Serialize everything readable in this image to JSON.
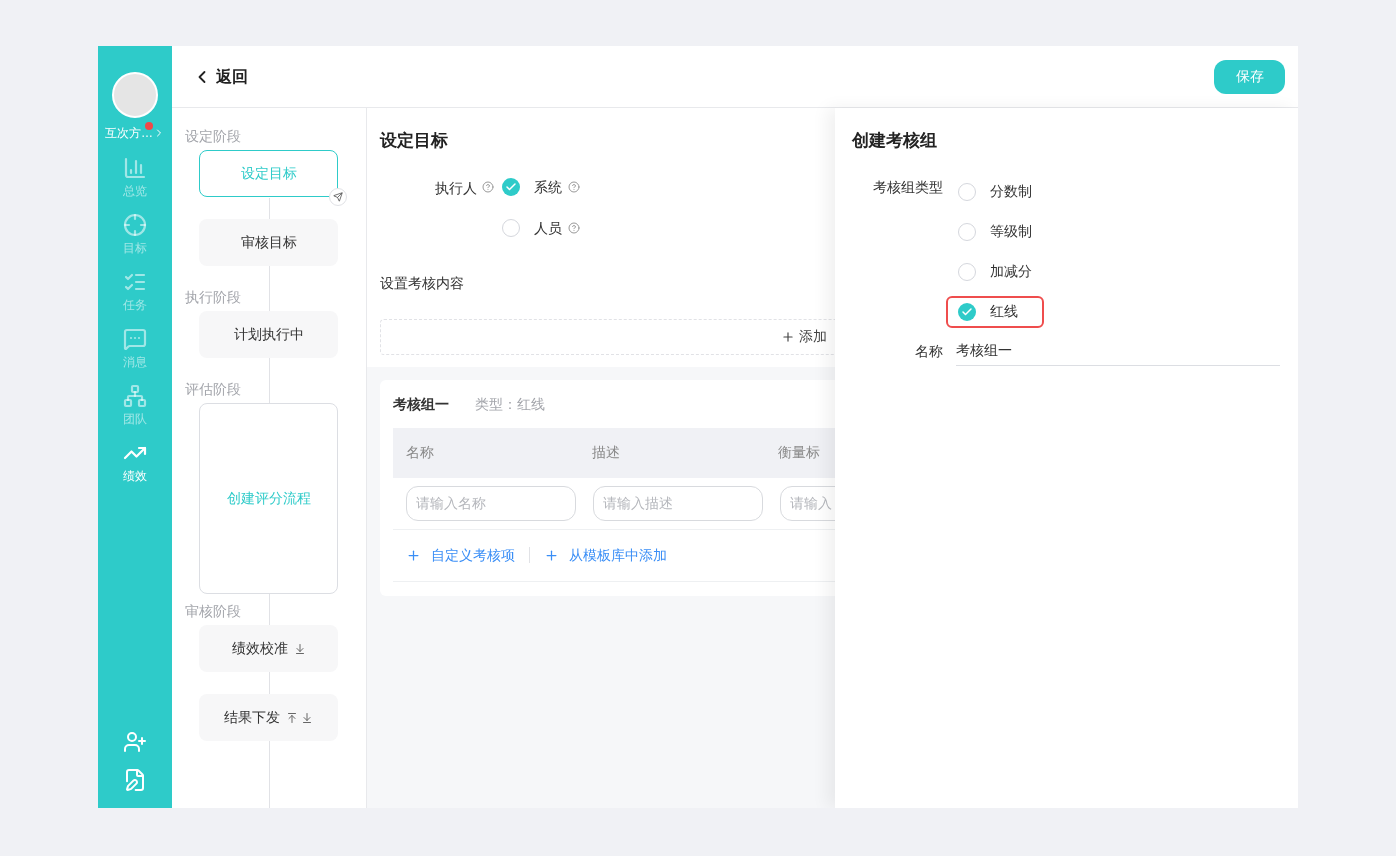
{
  "sidebar": {
    "user_name": "互次方…",
    "has_notification": true,
    "items": [
      {
        "kind": "overview",
        "label": "总览",
        "selected": false
      },
      {
        "kind": "target",
        "label": "目标",
        "selected": false
      },
      {
        "kind": "task",
        "label": "任务",
        "selected": false
      },
      {
        "kind": "message",
        "label": "消息",
        "selected": false
      },
      {
        "kind": "team",
        "label": "团队",
        "selected": false
      },
      {
        "kind": "performance",
        "label": "绩效",
        "selected": true
      }
    ],
    "bottom_tools": [
      {
        "kind": "add_user"
      },
      {
        "kind": "edit"
      }
    ]
  },
  "header": {
    "back_label": "返回",
    "save_button": "保存"
  },
  "flow": [
    {
      "kind": "stage",
      "label": "设定阶段"
    },
    {
      "kind": "step",
      "label": "设定目标",
      "selected": true,
      "move_up": false,
      "move_down": false
    },
    {
      "kind": "step",
      "label": "审核目标",
      "selected": false,
      "move_up": false,
      "move_down": false
    },
    {
      "kind": "stage",
      "label": "执行阶段"
    },
    {
      "kind": "step",
      "label": "计划执行中",
      "selected": false,
      "move_up": false,
      "move_down": false
    },
    {
      "kind": "stage",
      "label": "评估阶段"
    },
    {
      "kind": "block",
      "label": "创建评分流程"
    },
    {
      "kind": "stage",
      "label": "审核阶段"
    },
    {
      "kind": "step",
      "label": "绩效校准",
      "selected": false,
      "move_up": false,
      "move_down": true
    },
    {
      "kind": "step",
      "label": "结果下发",
      "selected": false,
      "move_up": true,
      "move_down": true
    }
  ],
  "goal_panel": {
    "title": "设定目标",
    "executor_label": "执行人",
    "executor_options": [
      {
        "label": "系统",
        "selected": true
      },
      {
        "label": "人员",
        "selected": false
      }
    ],
    "content_label": "设置考核内容",
    "add_label": "添加",
    "group_card": {
      "name": "考核组一",
      "type_text": "类型：红线",
      "columns": [
        "名称",
        "描述",
        "衡量标"
      ],
      "placeholders": [
        "请输入名称",
        "请输入描述",
        "请输入"
      ],
      "actions": [
        "自定义考核项",
        "从模板库中添加"
      ]
    }
  },
  "drawer": {
    "title": "创建考核组",
    "type_label": "考核组类型",
    "type_options": [
      {
        "label": "分数制",
        "selected": false,
        "highlighted": false
      },
      {
        "label": "等级制",
        "selected": false,
        "highlighted": false
      },
      {
        "label": "加减分",
        "selected": false,
        "highlighted": false
      },
      {
        "label": "红线",
        "selected": true,
        "highlighted": true
      }
    ],
    "name_label": "名称",
    "name_value": "考核组一"
  }
}
